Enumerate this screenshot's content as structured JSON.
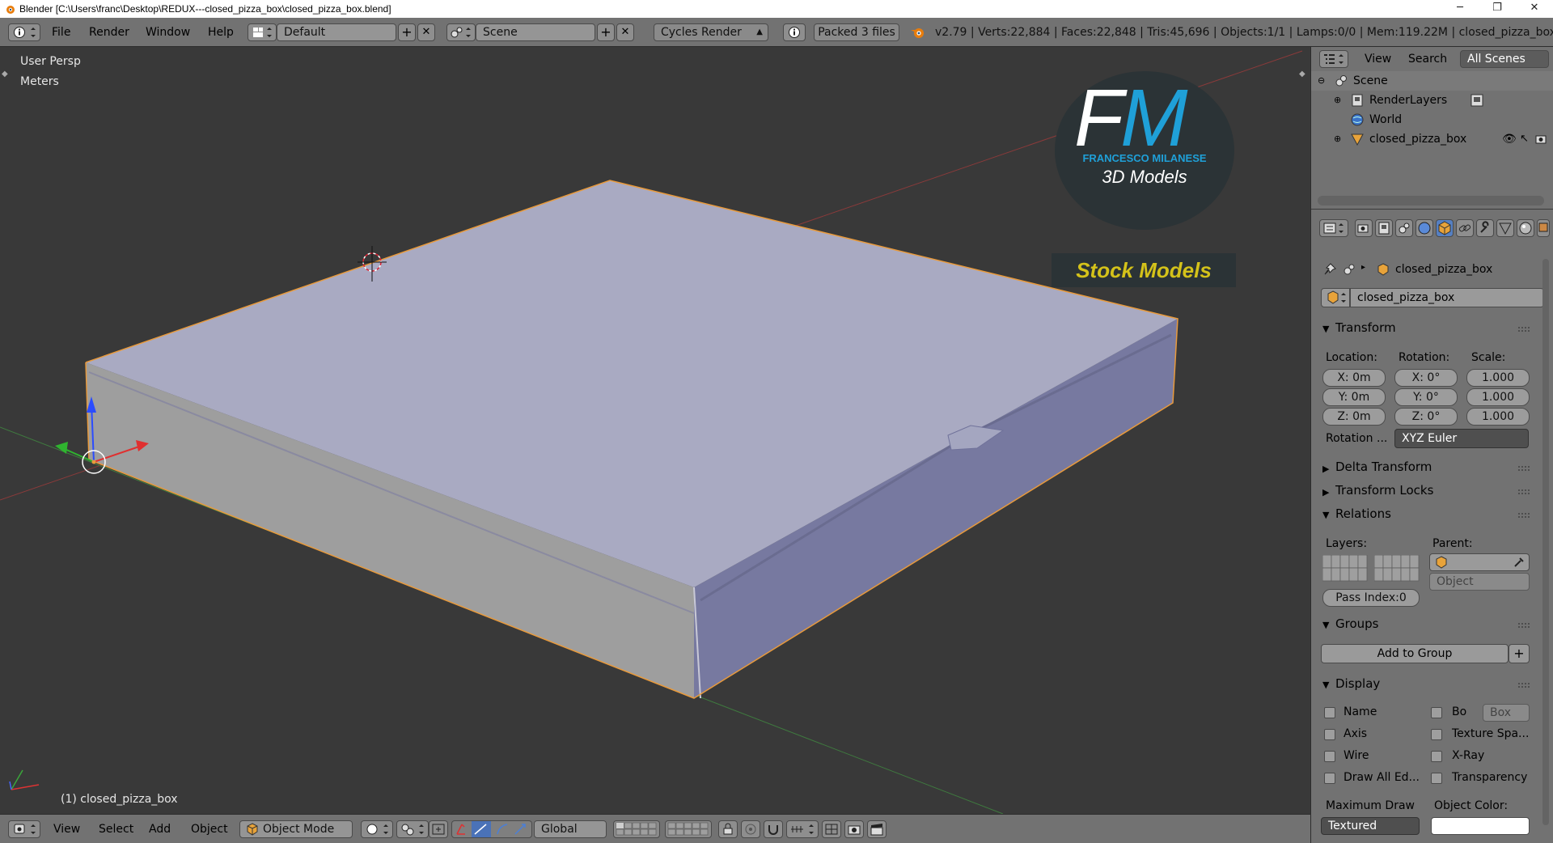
{
  "window": {
    "title": "Blender [C:\\Users\\franc\\Desktop\\REDUX---closed_pizza_box\\closed_pizza_box.blend]",
    "minimize": "─",
    "maximize": "❐",
    "close": "✕"
  },
  "info_header": {
    "menus": [
      "File",
      "Render",
      "Window",
      "Help"
    ],
    "screen_layout": "Default",
    "scene": "Scene",
    "render_engine": "Cycles Render",
    "packed": "Packed 3 files",
    "stats": "v2.79 | Verts:22,884 | Faces:22,848 | Tris:45,696 | Objects:1/1 | Lamps:0/0 | Mem:119.22M | closed_pizza_box"
  },
  "viewport": {
    "view_name": "User Persp",
    "units": "Meters",
    "object_label": "(1) closed_pizza_box",
    "watermark": {
      "big": "FM",
      "name": "FRANCESCO MILANESE",
      "sub": "3D Models",
      "banner": "Stock Models"
    }
  },
  "view_header": {
    "menus": [
      "View",
      "Select",
      "Add",
      "Object"
    ],
    "mode": "Object Mode",
    "orientation": "Global"
  },
  "outliner": {
    "menus": [
      "View",
      "Search"
    ],
    "display": "All Scenes",
    "items": [
      {
        "label": "Scene"
      },
      {
        "label": "RenderLayers"
      },
      {
        "label": "World"
      },
      {
        "label": "closed_pizza_box"
      }
    ]
  },
  "properties": {
    "breadcrumb": "closed_pizza_box",
    "object_name": "closed_pizza_box",
    "transform": {
      "title": "Transform",
      "location_label": "Location:",
      "rotation_label": "Rotation:",
      "scale_label": "Scale:",
      "location": [
        "X: 0m",
        "Y: 0m",
        "Z: 0m"
      ],
      "rotation": [
        "X:   0°",
        "Y:   0°",
        "Z:   0°"
      ],
      "scale": [
        "1.000",
        "1.000",
        "1.000"
      ],
      "rotation_mode_label": "Rotation ...",
      "rotation_mode": "XYZ Euler"
    },
    "delta_transform": "Delta Transform",
    "transform_locks": "Transform Locks",
    "relations": {
      "title": "Relations",
      "layers_label": "Layers:",
      "parent_label": "Parent:",
      "parent_type": "Object",
      "pass_index": "Pass Index:0"
    },
    "groups": {
      "title": "Groups",
      "add_button": "Add to Group"
    },
    "display": {
      "title": "Display",
      "checks_left": [
        "Name",
        "Axis",
        "Wire",
        "Draw All Ed..."
      ],
      "checks_right": [
        "Bo",
        "Texture Spa...",
        "X-Ray",
        "Transparency"
      ],
      "bounds_type": "Box",
      "max_draw_label": "Maximum Draw",
      "max_draw_value": "Textured",
      "object_color_label": "Object Color:"
    }
  }
}
